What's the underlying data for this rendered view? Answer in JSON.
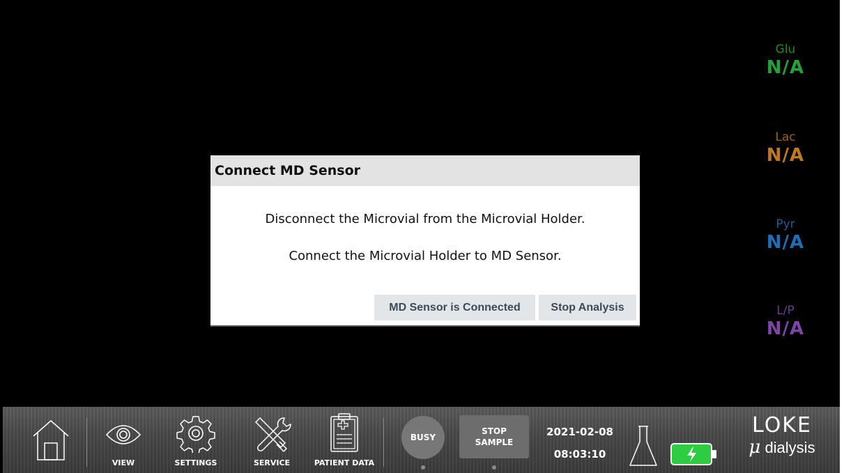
{
  "readouts": [
    {
      "label": "Glu",
      "value": "N/A",
      "label_color": "#1f8a2a",
      "value_color": "#21a336"
    },
    {
      "label": "Lac",
      "value": "N/A",
      "label_color": "#9c5e17",
      "value_color": "#c07820"
    },
    {
      "label": "Pyr",
      "value": "N/A",
      "label_color": "#1e5c93",
      "value_color": "#1f6fb8"
    },
    {
      "label": "L/P",
      "value": "N/A",
      "label_color": "#6a3a8c",
      "value_color": "#7e44a8"
    }
  ],
  "dialog": {
    "title": "Connect MD Sensor",
    "line1": "Disconnect the Microvial from the Microvial Holder.",
    "line2": "Connect the Microvial Holder to MD Sensor.",
    "confirm_label": "MD Sensor is Connected",
    "stop_label": "Stop Analysis"
  },
  "toolbar": {
    "home_icon": "home-icon",
    "view_label": "VIEW",
    "settings_label": "SETTINGS",
    "service_label": "SERVICE",
    "patient_data_label": "PATIENT DATA",
    "busy_label": "BUSY",
    "stop_sample_line1": "STOP",
    "stop_sample_line2": "SAMPLE",
    "date": "2021-02-08",
    "time": "08:03:10",
    "battery_color": "#2ecc40"
  },
  "brand": {
    "name": "LOKE",
    "mu": "μ",
    "subtitle": "dialysis"
  }
}
